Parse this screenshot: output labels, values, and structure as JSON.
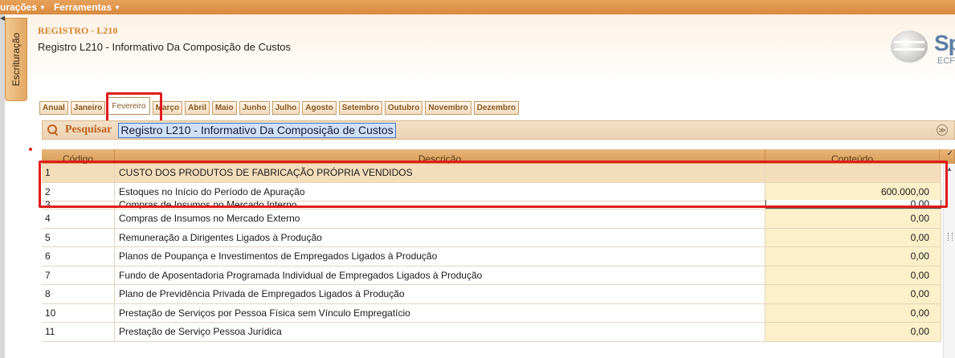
{
  "menu": [
    {
      "label": "urações"
    },
    {
      "label": "Ferramentas"
    }
  ],
  "sidebar_tab": "Escrituração",
  "header": {
    "code": "REGISTRO - L210",
    "title": "Registro L210 - Informativo Da Composição de Custos",
    "logo_text": "Sp",
    "logo_sub": "ECF"
  },
  "months": [
    "Anual",
    "Janeiro",
    "Fevereiro",
    "Março",
    "Abril",
    "Maio",
    "Junho",
    "Julho",
    "Agosto",
    "Setembro",
    "Outubro",
    "Novembro",
    "Dezembro"
  ],
  "active_month": "Fevereiro",
  "search": {
    "label": "Pesquisar",
    "value": "Registro L210 - Informativo Da Composição de Custos"
  },
  "grid": {
    "columns": [
      "Código",
      "Descrição",
      "Conteúdo"
    ],
    "rows": [
      {
        "code": "1",
        "desc": "CUSTO DOS PRODUTOS DE FABRICAÇÃO PRÓPRIA VENDIDOS",
        "value": ""
      },
      {
        "code": "2",
        "desc": "Estoques no Início do Período de Apuração",
        "value": "600.000,00"
      },
      {
        "code": "3",
        "desc": "Compras de Insumos no Mercado Interno",
        "value": "0,00"
      },
      {
        "code": "4",
        "desc": "Compras de Insumos no Mercado Externo",
        "value": "0,00"
      },
      {
        "code": "5",
        "desc": "Remuneração a Dirigentes Ligados à Produção",
        "value": "0,00"
      },
      {
        "code": "6",
        "desc": "Planos de Poupança e Investimentos de Empregados Ligados à Produção",
        "value": "0,00"
      },
      {
        "code": "7",
        "desc": "Fundo de Aposentadoria Programada Individual de Empregados Ligados à Produção",
        "value": "0,00"
      },
      {
        "code": "8",
        "desc": "Plano de Previdência Privada de Empregados Ligados à Produção",
        "value": "0,00"
      },
      {
        "code": "10",
        "desc": "Prestação de Serviços por Pessoa Física sem Vínculo Empregatício",
        "value": "0,00"
      },
      {
        "code": "11",
        "desc": "Prestação de Serviço Pessoa Jurídica",
        "value": "0,00"
      }
    ]
  },
  "colors": {
    "accent": "#d4822e",
    "highlight": "#e11b1b"
  }
}
